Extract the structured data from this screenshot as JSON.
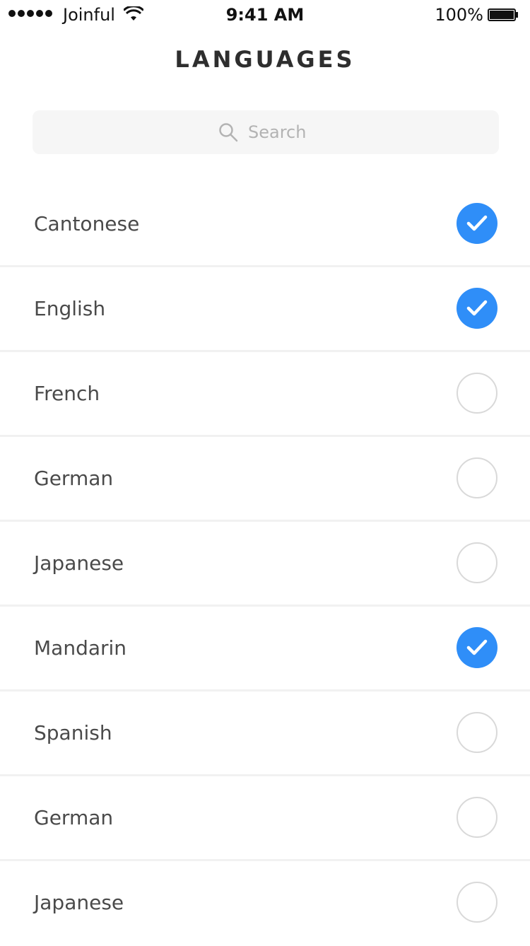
{
  "status_bar": {
    "carrier": "Joinful",
    "time": "9:41 AM",
    "battery": "100%"
  },
  "header": {
    "title": "LANGUAGES"
  },
  "search": {
    "placeholder": "Search",
    "value": ""
  },
  "colors": {
    "accent": "#2f8ef8"
  },
  "languages": [
    {
      "label": "Cantonese",
      "selected": true
    },
    {
      "label": "English",
      "selected": true
    },
    {
      "label": "French",
      "selected": false
    },
    {
      "label": "German",
      "selected": false
    },
    {
      "label": "Japanese",
      "selected": false
    },
    {
      "label": "Mandarin",
      "selected": true
    },
    {
      "label": "Spanish",
      "selected": false
    },
    {
      "label": "German",
      "selected": false
    },
    {
      "label": "Japanese",
      "selected": false
    }
  ]
}
